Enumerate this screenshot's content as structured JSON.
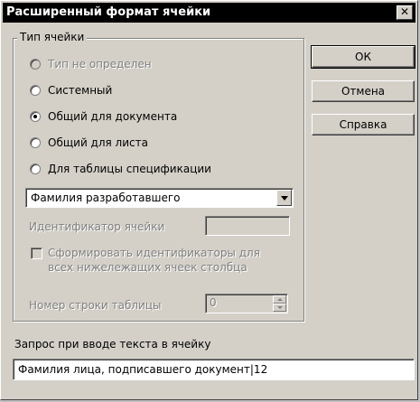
{
  "window": {
    "title": "Расширенный формат ячейки",
    "close_glyph": "✕"
  },
  "cell_type_group": {
    "legend": "Тип ячейки",
    "options": [
      {
        "label": "Тип не определен",
        "enabled": false,
        "selected": false
      },
      {
        "label": "Системный",
        "enabled": true,
        "selected": false
      },
      {
        "label": "Общий для документа",
        "enabled": true,
        "selected": true
      },
      {
        "label": "Общий для листа",
        "enabled": true,
        "selected": false
      },
      {
        "label": "Для таблицы спецификации",
        "enabled": true,
        "selected": false
      }
    ],
    "variable_select": {
      "value": "Фамилия разработавшего"
    },
    "cell_id": {
      "label": "Идентификатор ячейки",
      "value": ""
    },
    "generate_ids_checkbox": {
      "label_line1": "Сформировать идентификаторы  для",
      "label_line2": "всех нижележащих ячеек столбца",
      "checked": false
    },
    "table_row_number": {
      "label": "Номер строки таблицы",
      "value": "0"
    }
  },
  "buttons": {
    "ok": "ОК",
    "cancel": "Отмена",
    "help": "Справка"
  },
  "prompt": {
    "label": "Запрос при вводе текста в ячейку",
    "value": "Фамилия лица, подписавшего документ|12"
  }
}
